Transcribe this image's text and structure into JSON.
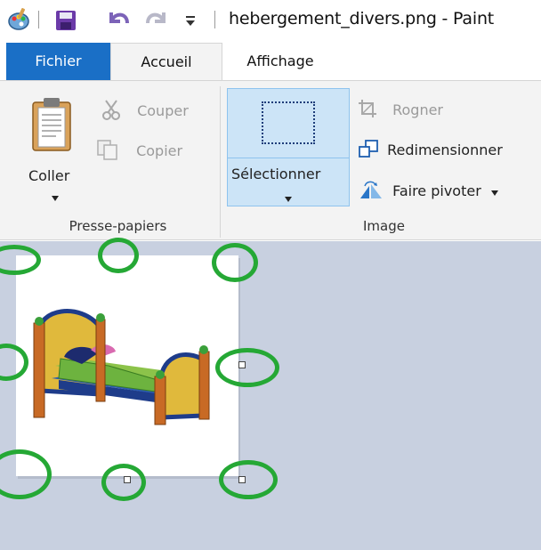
{
  "window": {
    "title": "hebergement_divers.png - Paint"
  },
  "tabs": [
    {
      "label": "Fichier"
    },
    {
      "label": "Accueil"
    },
    {
      "label": "Affichage"
    }
  ],
  "ribbon": {
    "clipboard": {
      "paste_label": "Coller",
      "cut_label": "Couper",
      "copy_label": "Copier",
      "group_label": "Presse-papiers"
    },
    "image": {
      "select_label": "Sélectionner",
      "crop_label": "Rogner",
      "resize_label": "Redimensionner",
      "rotate_label": "Faire pivoter",
      "group_label": "Image"
    }
  },
  "icons": {
    "app": "paint-palette-icon",
    "save": "floppy-disk-icon",
    "undo": "undo-arrow-icon",
    "redo": "redo-arrow-icon",
    "customize": "dropdown-arrow-icon",
    "paste": "clipboard-icon",
    "cut": "scissors-icon",
    "copy": "copy-pages-icon",
    "crop": "crop-icon",
    "resize": "resize-icon",
    "rotate": "rotate-icon",
    "canvas_image": "bed-image"
  },
  "colors": {
    "accent": "#1a6fc6",
    "ribbon_bg": "#f3f3f3",
    "selected_button": "#cce4f7",
    "canvas_workspace": "#c8d0e0",
    "annotation_circle": "#25a835"
  }
}
